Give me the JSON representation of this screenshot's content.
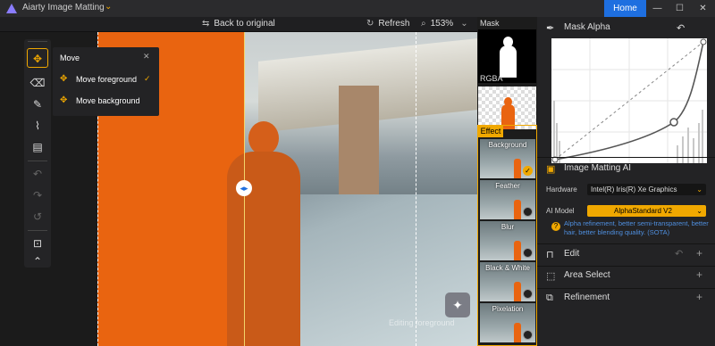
{
  "app": {
    "title": "Aiarty Image Matting",
    "home_label": "Home",
    "window_controls": {
      "minimize": "—",
      "maximize": "☐",
      "close": "✕"
    }
  },
  "toolbar": {
    "back_label": "Back to original",
    "refresh_label": "Refresh",
    "zoom_label": "153%"
  },
  "canvas": {
    "editing_label": "Editing foreground"
  },
  "tools": [
    {
      "name": "move-tool-icon",
      "glyph": "✥",
      "active": true
    },
    {
      "name": "eraser-tool-icon",
      "glyph": "⌫"
    },
    {
      "name": "pen-tool-icon",
      "glyph": "✎"
    },
    {
      "name": "brush-tool-icon",
      "glyph": "🖌"
    },
    {
      "name": "paint-roller-tool-icon",
      "glyph": "▤"
    },
    {
      "name": "undo-tool-icon",
      "glyph": "↶",
      "disabled": true
    },
    {
      "name": "redo-tool-icon",
      "glyph": "↷",
      "disabled": true
    },
    {
      "name": "reset-tool-icon",
      "glyph": "↺",
      "disabled": true
    },
    {
      "name": "fit-view-tool-icon",
      "glyph": "⊡"
    },
    {
      "name": "collapse-tool-icon",
      "glyph": "⌃"
    }
  ],
  "move_popup": {
    "title": "Move",
    "options": [
      {
        "label": "Move foreground",
        "selected": true
      },
      {
        "label": "Move background",
        "selected": false
      }
    ]
  },
  "thumbs": {
    "mask_label": "Mask",
    "rgba_label": "RGBA",
    "effect_label": "Effect",
    "effects": [
      {
        "label": "Background",
        "selected": true
      },
      {
        "label": "Feather",
        "selected": false
      },
      {
        "label": "Blur",
        "selected": false
      },
      {
        "label": "Black & White",
        "selected": false
      },
      {
        "label": "Pixelation",
        "selected": false
      }
    ]
  },
  "right_panel": {
    "mask_alpha_title": "Mask Alpha",
    "matting_title": "Image Matting AI",
    "hardware_label": "Hardware",
    "hardware_value": "Intel(R) Iris(R) Xe Graphics",
    "ai_model_label": "AI Model",
    "ai_model_value": "AlphaStandard  V2",
    "model_help": "Alpha refinement, better semi-transparent, better hair, better blending quality. (SOTA)",
    "edit_title": "Edit",
    "area_select_title": "Area Select",
    "refinement_title": "Refinement"
  },
  "colors": {
    "accent": "#f0a800",
    "home_blue": "#1e6fe0",
    "matte_orange": "#e96410",
    "help_blue": "#4f8fdf"
  }
}
